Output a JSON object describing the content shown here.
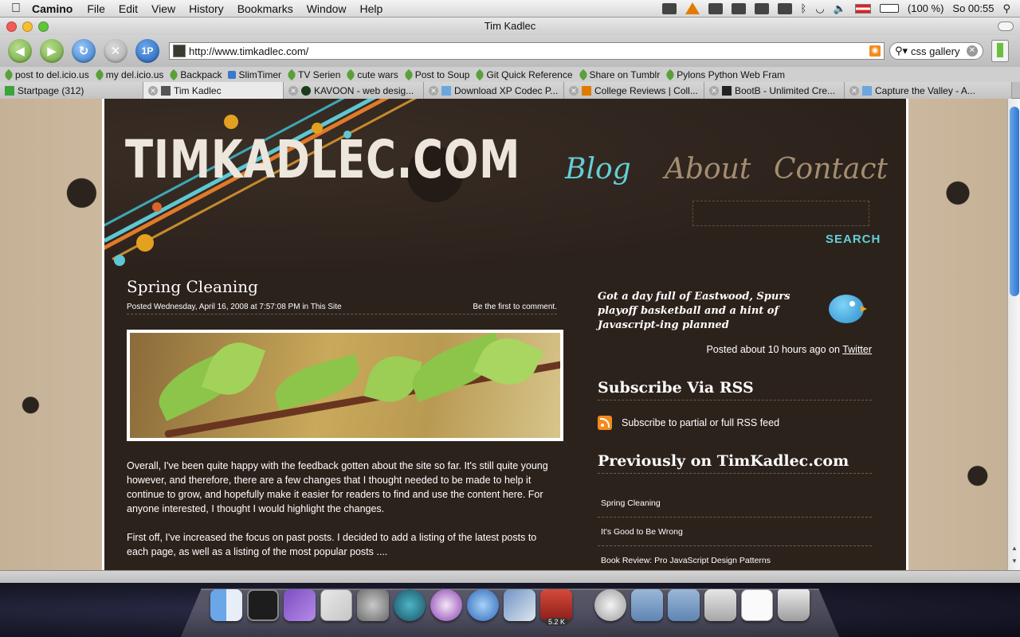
{
  "menubar": {
    "app_name": "Camino",
    "menus": [
      "File",
      "Edit",
      "View",
      "History",
      "Bookmarks",
      "Window",
      "Help"
    ],
    "battery_text": "(100 %)",
    "clock": "So 00:55",
    "status_icons": [
      "calendar-icon",
      "warning-icon",
      "paw-icon",
      "pin-icon",
      "display-icon",
      "memory-icon",
      "bluetooth-icon",
      "wifi-icon",
      "volume-icon",
      "flag-icon",
      "battery-icon",
      "spotlight-icon"
    ]
  },
  "window": {
    "title": "Tim Kadlec",
    "url": "http://www.timkadlec.com/",
    "search_value": "css gallery"
  },
  "bookmarks": [
    "post to del.icio.us",
    "my del.icio.us",
    "Backpack",
    "SlimTimer",
    "TV Serien",
    "cute wars",
    "Post to Soup",
    "Git Quick Reference",
    "Share on Tumblr",
    "Pylons Python Web Fram"
  ],
  "tabs": [
    {
      "label": "Startpage (312)",
      "icon": "plus-icon"
    },
    {
      "label": "Tim Kadlec",
      "icon": "site-icon"
    },
    {
      "label": "KAVOON - web desig...",
      "icon": "kavoon-icon"
    },
    {
      "label": "Download XP Codec P...",
      "icon": "download-icon"
    },
    {
      "label": "College Reviews | Coll...",
      "icon": "college-icon"
    },
    {
      "label": "BootB - Unlimited Cre...",
      "icon": "bootb-icon"
    },
    {
      "label": "Capture the Valley - A...",
      "icon": "bird-icon"
    }
  ],
  "site": {
    "logo": "TIMKADLEC.COM",
    "nav": {
      "blog": "Blog",
      "about": "About",
      "contact": "Contact"
    },
    "search_button": "SEARCH",
    "post": {
      "title": "Spring Cleaning",
      "meta": "Posted Wednesday, April 16, 2008 at 7:57:08 PM in This Site",
      "comments": "Be the first to comment.",
      "paragraphs": [
        "Overall, I've been quite happy with the feedback gotten about the site so far. It's still quite young however, and therefore, there are a few changes that I thought needed to be made to help it continue to grow, and hopefully make it easier for readers to find and use the content here. For anyone interested, I thought I would highlight the changes.",
        "First off, I've increased the focus on past posts. I decided to add a listing of the latest posts to each page, as well as a listing of the most popular posts ...."
      ]
    },
    "sidebar": {
      "tweet": "Got a day full of Eastwood, Spurs playoff basketball and a hint of Javascript-ing planned",
      "tweet_posted": "Posted about 10 hours ago on ",
      "tweet_source": "Twitter",
      "rss_heading": "Subscribe Via RSS",
      "rss_link": "Subscribe to partial or full RSS feed",
      "prev_heading": "Previously on TimKadlec.com",
      "prev_posts": [
        "Spring Cleaning",
        "It's Good to Be Wrong",
        "Book Review: Pro JavaScript Design Patterns"
      ]
    }
  },
  "dock": {
    "items": [
      "finder-icon",
      "terminal-icon",
      "app-icon",
      "css-edit-icon",
      "system-prefs-icon",
      "time-machine-icon",
      "adium-icon",
      "camino-icon",
      "iphoto-icon",
      "transmission-icon",
      "mail-icon",
      "folder-icon",
      "movies-folder-icon",
      "drive-icon",
      "document-icon",
      "trash-icon"
    ],
    "transmission_badge": "5.2 K"
  },
  "colors": {
    "page_bg": "#2c221c",
    "nav_active": "#63cfd6",
    "nav_inactive": "#a48e70",
    "rss": "#f48b1c"
  }
}
